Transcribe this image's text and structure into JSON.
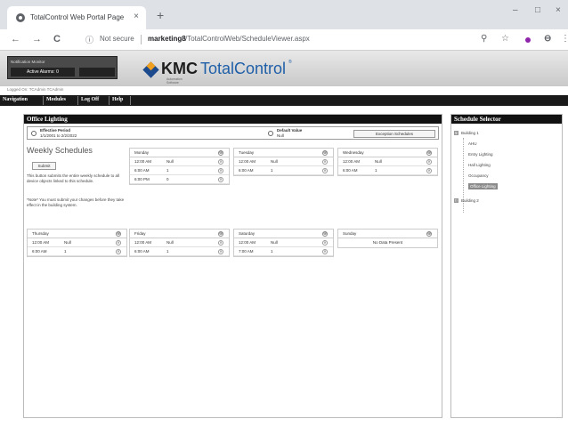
{
  "browser": {
    "tab_title": "TotalControl Web Portal Page",
    "tab_close": "×",
    "new_tab": "+",
    "window_controls": {
      "minimize": "–",
      "maximize": "□",
      "close": "×"
    },
    "nav": {
      "back": "←",
      "forward": "→",
      "reload": "C"
    },
    "security_icon": "ⓘ",
    "security_text": "Not secure",
    "url_host": "marketing8",
    "url_path": "/TotalControlWeb/ScheduleViewer.aspx",
    "right_icons": {
      "zoom": "⚲",
      "star": "☆",
      "account": "⊖",
      "menu": "⋮"
    }
  },
  "header": {
    "notification_label": "Notification Monitor",
    "active_alarms": "Active Alarms: 0",
    "logo_kmc": "KMC",
    "logo_tc": "TotalControl",
    "logo_tm": "®",
    "logo_sub": "Automation Software",
    "logged_in": "Logged On: TCAdmin TCAdmin"
  },
  "menu": {
    "items": [
      "Navigation",
      "Modules",
      "Log Off",
      "Help"
    ]
  },
  "main": {
    "title": "Office Lighting",
    "effective_label": "Effective Period",
    "effective_value": "1/1/2001 to 2/2/2022",
    "default_label": "Default Value",
    "default_value": "Null",
    "exception_button": "Exception Schedules",
    "weekly_title": "Weekly Schedules",
    "submit_button": "Submit",
    "desc_1": "This button submits the entire weekly schedule to all device objects linked to this schedule.",
    "desc_2": "*Note* You must submit your changes before they take effect in the building system.",
    "add_symbol": "⊕",
    "remove_symbol": "✕",
    "days": [
      {
        "name": "Monday",
        "entries": [
          {
            "time": "12:00 AM",
            "value": "Null"
          },
          {
            "time": "6:00 AM",
            "value": "1"
          },
          {
            "time": "6:00 PM",
            "value": "0"
          }
        ]
      },
      {
        "name": "Tuesday",
        "entries": [
          {
            "time": "12:00 AM",
            "value": "Null"
          },
          {
            "time": "6:00 AM",
            "value": "1"
          }
        ]
      },
      {
        "name": "Wednesday",
        "entries": [
          {
            "time": "12:00 AM",
            "value": "Null"
          },
          {
            "time": "6:00 AM",
            "value": "1"
          }
        ]
      },
      {
        "name": "Thursday",
        "entries": [
          {
            "time": "12:00 AM",
            "value": "Null"
          },
          {
            "time": "6:00 AM",
            "value": "1"
          }
        ]
      },
      {
        "name": "Friday",
        "entries": [
          {
            "time": "12:00 AM",
            "value": "Null"
          },
          {
            "time": "6:00 AM",
            "value": "1"
          }
        ]
      },
      {
        "name": "Saturday",
        "entries": [
          {
            "time": "12:00 AM",
            "value": "Null"
          },
          {
            "time": "7:00 AM",
            "value": "1"
          }
        ]
      },
      {
        "name": "Sunday",
        "entries": [],
        "no_data": "No Data Present"
      }
    ]
  },
  "selector": {
    "title": "Schedule Selector",
    "building1": "Building 1",
    "building2": "Building 2",
    "expand_symbol": "⊟",
    "collapse_symbol": "⊞",
    "leaves": [
      "AHU",
      "Entry Lighting",
      "Hall Lighting",
      "Occupancy",
      "Office Lighting"
    ],
    "selected": "Office Lighting"
  },
  "colors": {
    "header_black": "#111111",
    "kmc_blue": "#1f5fa8",
    "logo_orange": "#f0a020",
    "selected_gray": "#8a8a8a"
  }
}
